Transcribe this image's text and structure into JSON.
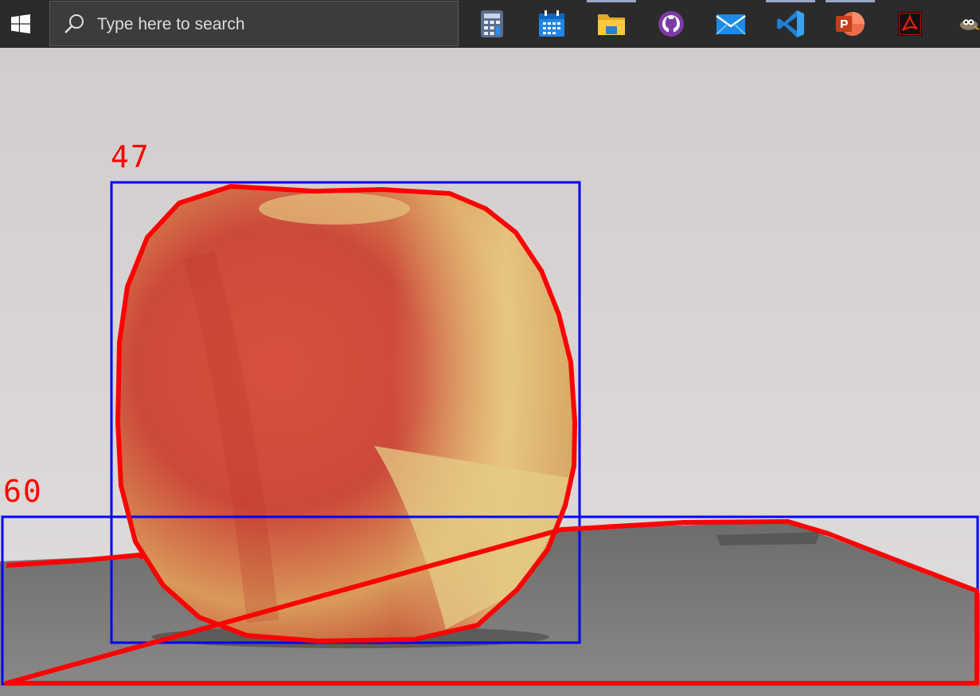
{
  "taskbar": {
    "search": {
      "placeholder": "Type here to search"
    },
    "start_icon": "windows-logo-icon",
    "pinned": [
      {
        "name": "calculator-icon"
      },
      {
        "name": "calendar-icon"
      },
      {
        "name": "file-explorer-icon"
      },
      {
        "name": "github-desktop-icon"
      },
      {
        "name": "mail-icon"
      },
      {
        "name": "vscode-icon"
      },
      {
        "name": "powerpoint-icon"
      },
      {
        "name": "acrobat-icon"
      },
      {
        "name": "gimp-icon"
      }
    ]
  },
  "image": {
    "subject": "apple",
    "detections": [
      {
        "label": "47",
        "box_color": "#0000ff",
        "contour_color": "#ff0000"
      },
      {
        "label": "60",
        "box_color": "#0000ff",
        "contour_color": "#ff0000"
      }
    ]
  }
}
